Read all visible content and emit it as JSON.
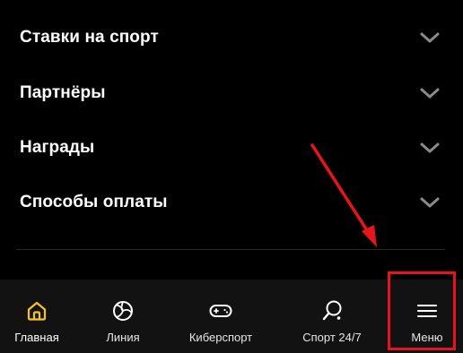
{
  "accordion": {
    "items": [
      {
        "label": "Ставки на спорт",
        "icon": "chevron-down-icon"
      },
      {
        "label": "Партнёры",
        "icon": "chevron-down-icon"
      },
      {
        "label": "Награды",
        "icon": "chevron-down-icon"
      },
      {
        "label": "Способы оплаты",
        "icon": "chevron-down-icon"
      }
    ]
  },
  "tabbar": {
    "active_color": "#f5c518",
    "items": [
      {
        "label": "Главная",
        "icon": "home-icon",
        "active": true
      },
      {
        "label": "Линия",
        "icon": "volleyball-icon",
        "active": false
      },
      {
        "label": "Киберспорт",
        "icon": "gamepad-icon",
        "active": false
      },
      {
        "label": "Спорт 24/7",
        "icon": "ping-pong-icon",
        "active": false
      },
      {
        "label": "Меню",
        "icon": "hamburger-menu-icon",
        "active": false
      }
    ]
  },
  "annotation": {
    "color": "#e8141b",
    "target": "Меню"
  }
}
